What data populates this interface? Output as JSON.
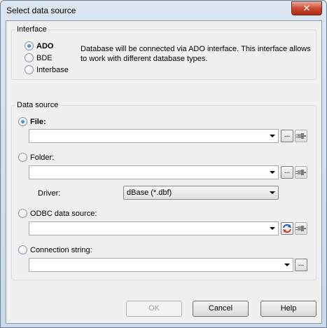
{
  "window": {
    "title": "Select data source",
    "close_label": "✕"
  },
  "interface": {
    "group_title": "Interface",
    "options": [
      {
        "label": "ADO",
        "checked": true,
        "bold": true
      },
      {
        "label": "BDE",
        "checked": false,
        "bold": false
      },
      {
        "label": "Interbase",
        "checked": false,
        "bold": false
      }
    ],
    "description": "Database will be connected via ADO interface. This interface allows to work with different database types."
  },
  "data_source": {
    "group_title": "Data source",
    "file_label": "File:",
    "file_value": "",
    "folder_label": "Folder:",
    "folder_value": "",
    "driver_label": "Driver:",
    "driver_value": "dBase (*.dbf)",
    "odbc_label": "ODBC data source:",
    "odbc_value": "",
    "conn_label": "Connection string:",
    "conn_value": "",
    "browse_label": "..."
  },
  "buttons": {
    "ok": "OK",
    "cancel": "Cancel",
    "help": "Help"
  }
}
